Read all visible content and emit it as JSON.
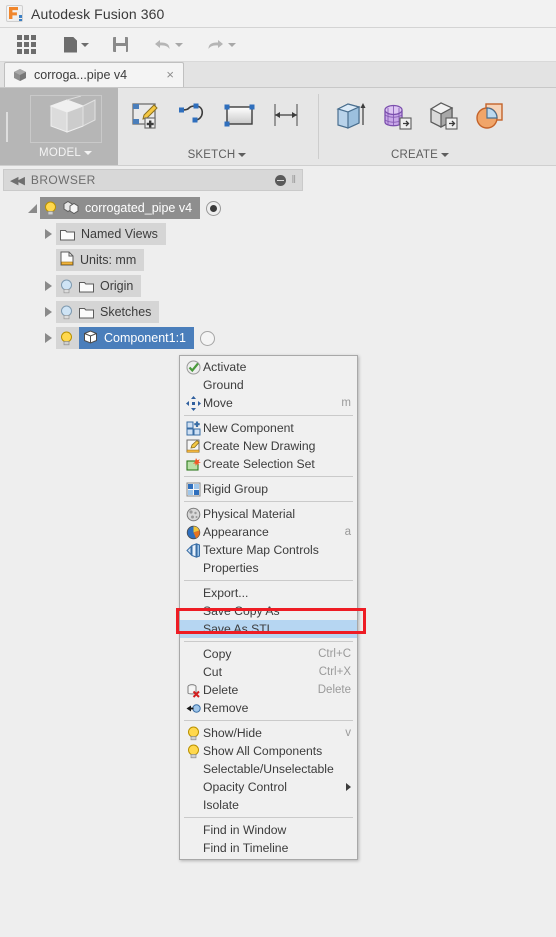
{
  "titlebar": {
    "app_title": "Autodesk Fusion 360",
    "logo_icon": "fusion360-logo-icon"
  },
  "quick_access": {
    "items": [
      {
        "name": "app-grid-button",
        "icon": "grid-icon"
      },
      {
        "name": "new-document-button",
        "icon": "document-icon",
        "has_caret": true
      },
      {
        "name": "save-button",
        "icon": "save-icon"
      },
      {
        "name": "undo-button",
        "icon": "undo-arrow-icon",
        "has_caret": true
      },
      {
        "name": "redo-button",
        "icon": "redo-arrow-icon",
        "has_caret": true
      }
    ]
  },
  "tabs": [
    {
      "label": "corroga...pipe v4",
      "icon": "cube-icon",
      "close_label": "×",
      "active": true
    }
  ],
  "ribbon": {
    "model_panel": {
      "label": "MODEL",
      "thumb_icon": "model-cube-icon"
    },
    "sketch_panel": {
      "label": "SKETCH",
      "tools": [
        {
          "name": "create-sketch-tool",
          "icon": "sketch-create-icon"
        },
        {
          "name": "spline-tool",
          "icon": "spline-icon"
        },
        {
          "name": "rectangle-tool",
          "icon": "rectangle-icon"
        },
        {
          "name": "sketch-dimension-tool",
          "icon": "dimension-icon"
        }
      ]
    },
    "create_panel": {
      "label": "CREATE",
      "tools": [
        {
          "name": "extrude-tool",
          "icon": "extrude-icon"
        },
        {
          "name": "create-form-tool",
          "icon": "form-mesh-icon"
        },
        {
          "name": "create-pcb-tool",
          "icon": "solid-insert-icon"
        },
        {
          "name": "create-sketch-geometry-tool",
          "icon": "circle-square-icon"
        }
      ]
    }
  },
  "browser": {
    "header": {
      "title": "BROWSER",
      "collapse_icon": "collapse-arrows-icon",
      "minimize_icon": "minus-circle-icon",
      "grip_icon": "grip-icon"
    },
    "tree": [
      {
        "label": "corrogated_pipe v4",
        "icon": "assembly-icon",
        "bulb": true,
        "expander": "open",
        "style": "dark",
        "indent": 0,
        "radio": "filled"
      },
      {
        "label": "Named Views",
        "icon": "folder-icon",
        "bulb": false,
        "expander": "closed",
        "style": "grey",
        "indent": 1
      },
      {
        "label": "Units: mm",
        "icon": "units-document-icon",
        "bulb": false,
        "expander": "none",
        "style": "grey",
        "indent": 1
      },
      {
        "label": "Origin",
        "icon": "folder-icon",
        "bulb": true,
        "expander": "closed",
        "style": "grey",
        "indent": 1
      },
      {
        "label": "Sketches",
        "icon": "folder-icon",
        "bulb": true,
        "expander": "closed",
        "style": "grey",
        "indent": 1
      },
      {
        "label": "Component1:1",
        "icon": "component-cube-icon",
        "bulb": true,
        "expander": "closed",
        "style": "selected",
        "indent": 1,
        "radio": "empty"
      }
    ]
  },
  "context_menu": {
    "groups": [
      {
        "items": [
          {
            "label": "Activate",
            "icon": "activate-check-icon",
            "shortcut": "",
            "selected": false
          },
          {
            "label": "Ground",
            "icon": "",
            "shortcut": "",
            "selected": false
          },
          {
            "label": "Move",
            "icon": "move-arrows-icon",
            "shortcut": "m",
            "selected": false
          }
        ]
      },
      {
        "items": [
          {
            "label": "New Component",
            "icon": "new-component-icon",
            "shortcut": "",
            "selected": false
          },
          {
            "label": "Create New Drawing",
            "icon": "create-drawing-icon",
            "shortcut": "",
            "selected": false
          },
          {
            "label": "Create Selection Set",
            "icon": "selection-set-icon",
            "shortcut": "",
            "selected": false
          }
        ]
      },
      {
        "items": [
          {
            "label": "Rigid Group",
            "icon": "rigid-group-icon",
            "shortcut": "",
            "selected": false
          }
        ]
      },
      {
        "items": [
          {
            "label": "Physical Material",
            "icon": "physical-material-icon",
            "shortcut": "",
            "selected": false
          },
          {
            "label": "Appearance",
            "icon": "appearance-icon",
            "shortcut": "a",
            "selected": false
          },
          {
            "label": "Texture Map Controls",
            "icon": "texture-map-icon",
            "shortcut": "",
            "selected": false
          },
          {
            "label": "Properties",
            "icon": "",
            "shortcut": "",
            "selected": false
          }
        ]
      },
      {
        "items": [
          {
            "label": "Export...",
            "icon": "",
            "shortcut": "",
            "selected": false
          },
          {
            "label": "Save Copy As",
            "icon": "",
            "shortcut": "",
            "selected": false
          },
          {
            "label": "Save As STL",
            "icon": "",
            "shortcut": "",
            "selected": true
          }
        ]
      },
      {
        "items": [
          {
            "label": "Copy",
            "icon": "",
            "shortcut": "Ctrl+C",
            "selected": false
          },
          {
            "label": "Cut",
            "icon": "",
            "shortcut": "Ctrl+X",
            "selected": false
          },
          {
            "label": "Delete",
            "icon": "delete-icon",
            "shortcut": "Delete",
            "selected": false
          },
          {
            "label": "Remove",
            "icon": "remove-icon",
            "shortcut": "",
            "selected": false
          }
        ]
      },
      {
        "items": [
          {
            "label": "Show/Hide",
            "icon": "bulb-icon",
            "shortcut": "v",
            "selected": false
          },
          {
            "label": "Show All Components",
            "icon": "bulb-icon",
            "shortcut": "",
            "selected": false
          },
          {
            "label": "Selectable/Unselectable",
            "icon": "",
            "shortcut": "",
            "selected": false
          },
          {
            "label": "Opacity Control",
            "icon": "",
            "shortcut": "",
            "submenu": true,
            "selected": false
          },
          {
            "label": "Isolate",
            "icon": "",
            "shortcut": "",
            "selected": false
          }
        ]
      },
      {
        "items": [
          {
            "label": "Find in Window",
            "icon": "",
            "shortcut": "",
            "selected": false
          },
          {
            "label": "Find in Timeline",
            "icon": "",
            "shortcut": "",
            "selected": false
          }
        ]
      }
    ]
  },
  "annotation": {
    "name": "red-highlight-box",
    "color": "#ee1c24",
    "targets": "Save As STL"
  },
  "colors": {
    "selection_blue": "#4a7ebb",
    "menu_highlight": "#b6d6f2",
    "annotation_red": "#ee1c24",
    "panel_grey": "#e6e6e6",
    "background": "#eeeeee"
  }
}
